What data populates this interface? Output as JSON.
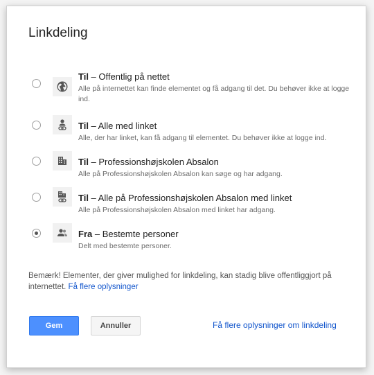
{
  "dialog": {
    "title": "Linkdeling"
  },
  "options": [
    {
      "status": "Til",
      "label": " – Offentlig på nettet",
      "description": "Alle på internettet kan finde elementet og få adgang til det. Du behøver ikke at logge ind.",
      "icon": "globe-icon",
      "selected": false
    },
    {
      "status": "Til",
      "label": " – Alle med linket",
      "description": "Alle, der har linket, kan få adgang til elementet. Du behøver ikke at logge ind.",
      "icon": "person-link-icon",
      "selected": false
    },
    {
      "status": "Til",
      "label": " – Professionshøjskolen Absalon",
      "description": "Alle på Professionshøjskolen Absalon kan søge og har adgang.",
      "icon": "building-icon",
      "selected": false
    },
    {
      "status": "Til",
      "label": " – Alle på Professionshøjskolen Absalon med linket",
      "description": "Alle på Professionshøjskolen Absalon med linket har adgang.",
      "icon": "building-link-icon",
      "selected": false
    },
    {
      "status": "Fra",
      "label": " – Bestemte personer",
      "description": "Delt med bestemte personer.",
      "icon": "people-icon",
      "selected": true
    }
  ],
  "note": {
    "text": "Bemærk! Elementer, der giver mulighed for linkdeling, kan stadig blive offentliggjort på internettet. ",
    "link": "Få flere oplysninger"
  },
  "buttons": {
    "save": "Gem",
    "cancel": "Annuller"
  },
  "footer_link": "Få flere oplysninger om linkdeling",
  "colors": {
    "primary": "#4d90fe",
    "link": "#1155cc"
  }
}
